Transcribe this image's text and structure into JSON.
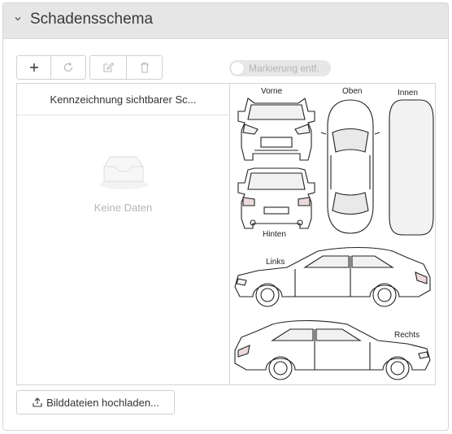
{
  "panel": {
    "title": "Schadensschema"
  },
  "toolbar": {
    "add_icon": "plus-icon",
    "refresh_icon": "refresh-icon",
    "edit_icon": "edit-icon",
    "delete_icon": "trash-icon"
  },
  "toggle": {
    "label": "Markierung entf.",
    "on": false
  },
  "grid": {
    "column_header": "Kennzeichnung sichtbarer Sc...",
    "empty_text": "Keine Daten"
  },
  "scheme": {
    "labels": {
      "front": "Vorne",
      "top": "Oben",
      "interior": "Innen",
      "rear": "Hinten",
      "left": "Links",
      "right": "Rechts"
    }
  },
  "upload": {
    "label": "Bilddateien hochladen..."
  }
}
